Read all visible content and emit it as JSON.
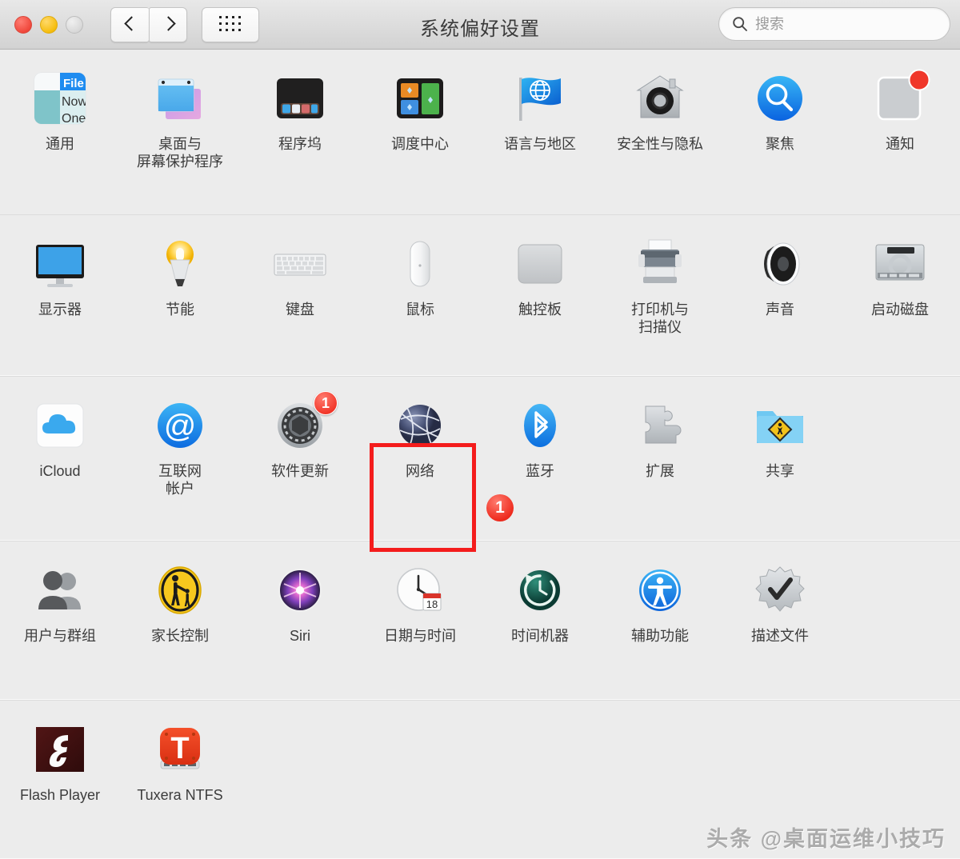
{
  "window": {
    "title": "系统偏好设置",
    "traffic_lights": [
      "close-red",
      "minimize-yellow",
      "zoom-gray-disabled"
    ],
    "nav": {
      "back_label": "‹",
      "forward_label": "›"
    },
    "grid_button_name": "show-all-grid"
  },
  "search": {
    "value": "",
    "placeholder": "搜索"
  },
  "annotation": {
    "highlight_target": "网络",
    "highlight_color": "#f41c1c",
    "marker_number": "1",
    "marker_color": "#ee2a1d"
  },
  "watermark": "头条 @桌面运维小技巧",
  "rows": [
    {
      "id": "row-personal",
      "items": [
        {
          "name": "general",
          "label": "通用",
          "icon": "general-icon"
        },
        {
          "name": "desktop-saver",
          "label": "桌面与\n屏幕保护程序",
          "icon": "desktop-screensaver-icon"
        },
        {
          "name": "dock",
          "label": "程序坞",
          "icon": "dock-icon"
        },
        {
          "name": "mission-control",
          "label": "调度中心",
          "icon": "mission-control-icon"
        },
        {
          "name": "language-region",
          "label": "语言与地区",
          "icon": "language-region-icon"
        },
        {
          "name": "security",
          "label": "安全性与隐私",
          "icon": "security-privacy-icon"
        },
        {
          "name": "spotlight",
          "label": "聚焦",
          "icon": "spotlight-icon"
        },
        {
          "name": "notifications",
          "label": "通知",
          "icon": "notifications-icon",
          "badge_dot": true
        }
      ]
    },
    {
      "id": "row-hardware",
      "items": [
        {
          "name": "displays",
          "label": "显示器",
          "icon": "displays-icon"
        },
        {
          "name": "energy-saver",
          "label": "节能",
          "icon": "energy-saver-icon"
        },
        {
          "name": "keyboard",
          "label": "键盘",
          "icon": "keyboard-icon"
        },
        {
          "name": "mouse",
          "label": "鼠标",
          "icon": "mouse-icon"
        },
        {
          "name": "trackpad",
          "label": "触控板",
          "icon": "trackpad-icon"
        },
        {
          "name": "printers",
          "label": "打印机与\n扫描仪",
          "icon": "printers-scanners-icon"
        },
        {
          "name": "sound",
          "label": "声音",
          "icon": "sound-icon"
        },
        {
          "name": "startup-disk",
          "label": "启动磁盘",
          "icon": "startup-disk-icon"
        }
      ]
    },
    {
      "id": "row-internet",
      "items": [
        {
          "name": "icloud",
          "label": "iCloud",
          "icon": "icloud-icon"
        },
        {
          "name": "internet-accounts",
          "label": "互联网\n帐户",
          "icon": "internet-accounts-icon"
        },
        {
          "name": "software-update",
          "label": "软件更新",
          "icon": "software-update-icon",
          "badge": "1"
        },
        {
          "name": "network",
          "label": "网络",
          "icon": "network-icon",
          "highlighted": true
        },
        {
          "name": "bluetooth",
          "label": "蓝牙",
          "icon": "bluetooth-icon"
        },
        {
          "name": "extensions",
          "label": "扩展",
          "icon": "extensions-icon"
        },
        {
          "name": "sharing",
          "label": "共享",
          "icon": "sharing-icon"
        }
      ]
    },
    {
      "id": "row-system",
      "items": [
        {
          "name": "users-groups",
          "label": "用户与群组",
          "icon": "users-groups-icon"
        },
        {
          "name": "parental-controls",
          "label": "家长控制",
          "icon": "parental-controls-icon"
        },
        {
          "name": "siri",
          "label": "Siri",
          "icon": "siri-icon"
        },
        {
          "name": "date-time",
          "label": "日期与时间",
          "icon": "date-time-icon"
        },
        {
          "name": "time-machine",
          "label": "时间机器",
          "icon": "time-machine-icon"
        },
        {
          "name": "accessibility",
          "label": "辅助功能",
          "icon": "accessibility-icon"
        },
        {
          "name": "profiles",
          "label": "描述文件",
          "icon": "profiles-icon"
        }
      ]
    },
    {
      "id": "row-thirdparty",
      "items": [
        {
          "name": "flash-player",
          "label": "Flash Player",
          "icon": "flash-player-icon"
        },
        {
          "name": "tuxera-ntfs",
          "label": "Tuxera NTFS",
          "icon": "tuxera-ntfs-icon"
        }
      ]
    }
  ]
}
